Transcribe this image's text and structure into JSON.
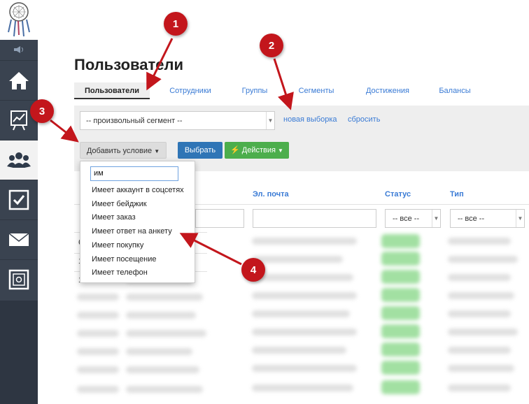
{
  "page": {
    "title": "Пользователи"
  },
  "sidebar": {
    "items": [
      {
        "name": "home",
        "icon": "home-icon"
      },
      {
        "name": "stats",
        "icon": "chart-icon"
      },
      {
        "name": "users",
        "icon": "users-icon",
        "active": true
      },
      {
        "name": "tasks",
        "icon": "checkbox-icon"
      },
      {
        "name": "mail",
        "icon": "mail-icon"
      },
      {
        "name": "safe",
        "icon": "safe-icon"
      }
    ]
  },
  "tabs": [
    {
      "label": "Пользователи",
      "active": true
    },
    {
      "label": "Сотрудники"
    },
    {
      "label": "Группы"
    },
    {
      "label": "Сегменты"
    },
    {
      "label": "Достижения"
    },
    {
      "label": "Балансы"
    }
  ],
  "toolbar": {
    "segment_value": "-- произвольный сегмент --",
    "new_selection": "новая выборка",
    "reset": "сбросить",
    "add_condition": "Добавить условие",
    "select": "Выбрать",
    "actions": "Действия"
  },
  "table": {
    "headers": [
      "Эл. почта",
      "Статус",
      "Тип"
    ],
    "status_filter": "-- все --",
    "type_filter": "-- все --"
  },
  "dropdown": {
    "search_value": "им",
    "items": [
      "Имеет аккаунт в соцсетях",
      "Имеет бейджик",
      "Имеет заказ",
      "Имеет ответ на анкету",
      "Имеет покупку",
      "Имеет посещение",
      "Имеет телефон"
    ]
  },
  "annotations": [
    "1",
    "2",
    "3",
    "4"
  ],
  "colors": {
    "sidebar": "#3a4350",
    "accent": "#3a7bd5",
    "marker": "#c3161c",
    "primary": "#2f75b6",
    "success": "#4cae4c"
  }
}
